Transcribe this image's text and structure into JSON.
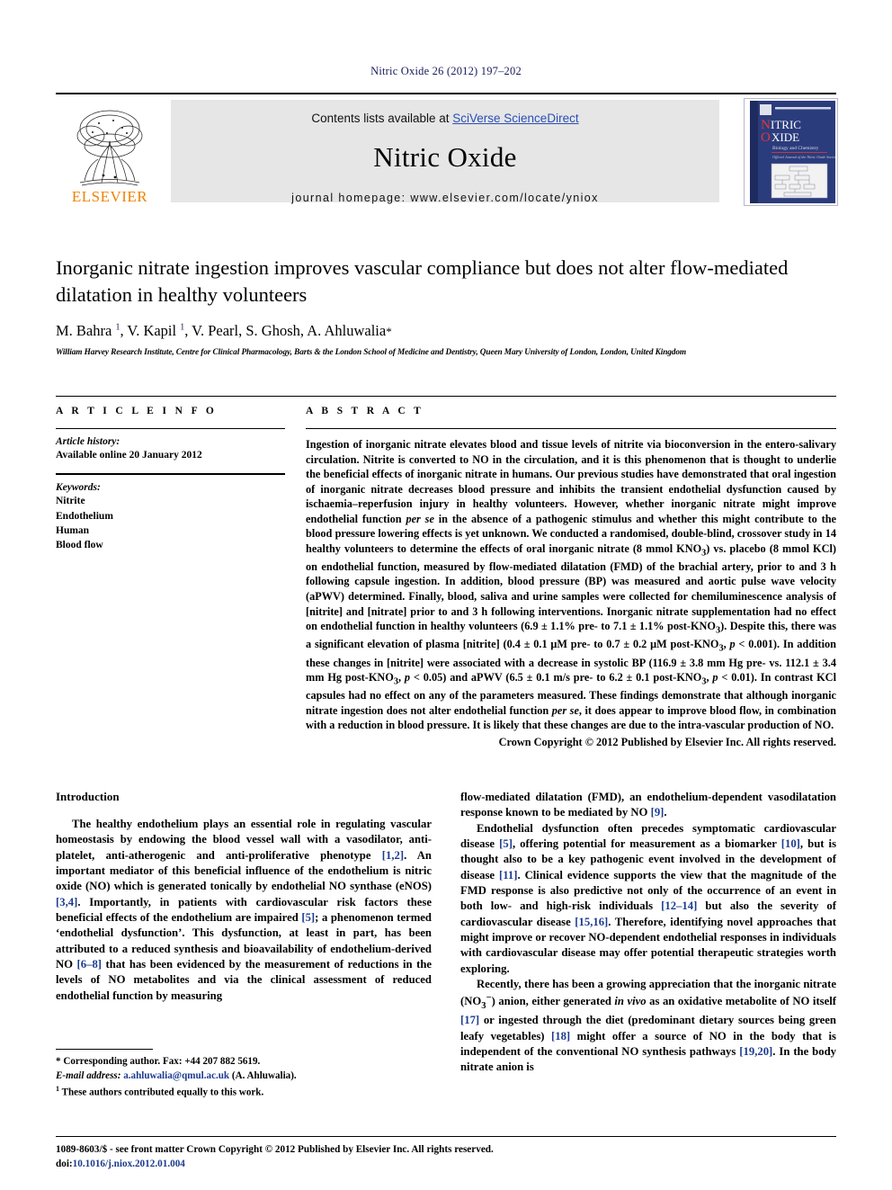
{
  "running_head": "Nitric Oxide 26 (2012) 197–202",
  "header": {
    "publisher_name": "ELSEVIER",
    "contents_prefix": "Contents lists available at ",
    "contents_link": "SciVerse ScienceDirect",
    "journal_title": "Nitric Oxide",
    "homepage_label": "journal homepage: www.elsevier.com/locate/yniox",
    "cover": {
      "line1": "NITRIC",
      "line2": "OXIDE",
      "subtitle": "Biology and Chemistry",
      "society": "Official Journal of the Nitric Oxide Society"
    },
    "link_color": "#2a4fb5"
  },
  "article": {
    "title": "Inorganic nitrate ingestion improves vascular compliance but does not alter flow-mediated dilatation in healthy volunteers",
    "authors_html": "M. Bahra <sup>1</sup>, V. Kapil <sup>1</sup>, V. Pearl, S. Ghosh, A. Ahluwalia<span class=\"star\">*</span>",
    "affiliation": "William Harvey Research Institute, Centre for Clinical Pharmacology, Barts & the London School of Medicine and Dentistry, Queen Mary University of London, London, United Kingdom"
  },
  "article_info": {
    "heading": "A R T I C L E   I N F O",
    "history_label": "Article history:",
    "history_value": "Available online 20 January 2012",
    "keywords_label": "Keywords:",
    "keywords": [
      "Nitrite",
      "Endothelium",
      "Human",
      "Blood flow"
    ]
  },
  "abstract": {
    "heading": "A B S T R A C T",
    "body_html": "Ingestion of inorganic nitrate elevates blood and tissue levels of nitrite via bioconversion in the entero-salivary circulation. Nitrite is converted to NO in the circulation, and it is this phenomenon that is thought to underlie the beneficial effects of inorganic nitrate in humans. Our previous studies have demonstrated that oral ingestion of inorganic nitrate decreases blood pressure and inhibits the transient endothelial dysfunction caused by ischaemia–reperfusion injury in healthy volunteers. However, whether inorganic nitrate might improve endothelial function <span class=\"ital\">per se</span> in the absence of a pathogenic stimulus and whether this might contribute to the blood pressure lowering effects is yet unknown. We conducted a randomised, double-blind, crossover study in 14 healthy volunteers to determine the effects of oral inorganic nitrate (8 mmol KNO<sub>3</sub>) vs. placebo (8 mmol KCl) on endothelial function, measured by flow-mediated dilatation (FMD) of the brachial artery, prior to and 3 h following capsule ingestion. In addition, blood pressure (BP) was measured and aortic pulse wave velocity (aPWV) determined. Finally, blood, saliva and urine samples were collected for chemiluminescence analysis of [nitrite] and [nitrate] prior to and 3 h following interventions. Inorganic nitrate supplementation had no effect on endothelial function in healthy volunteers (6.9 ± 1.1% pre- to 7.1 ± 1.1% post-KNO<sub>3</sub>). Despite this, there was a significant elevation of plasma [nitrite] (0.4 ± 0.1 μM pre- to 0.7 ± 0.2 μM post-KNO<sub>3</sub>, <span class=\"ital\">p</span> &lt; 0.001). In addition these changes in [nitrite] were associated with a decrease in systolic BP (116.9 ± 3.8 mm Hg pre- vs. 112.1 ± 3.4 mm Hg post-KNO<sub>3</sub>, <span class=\"ital\">p</span> &lt; 0.05) and aPWV (6.5 ± 0.1 m/s pre- to 6.2 ± 0.1 post-KNO<sub>3</sub>, <span class=\"ital\">p</span> &lt; 0.01). In contrast KCl capsules had no effect on any of the parameters measured. These findings demonstrate that although inorganic nitrate ingestion does not alter endothelial function <span class=\"ital\">per se</span>, it does appear to improve blood flow, in combination with a reduction in blood pressure. It is likely that these changes are due to the intra-vascular production of NO.",
    "copyright": "Crown Copyright © 2012 Published by Elsevier Inc. All rights reserved."
  },
  "introduction": {
    "heading": "Introduction",
    "left_p1_html": "The healthy endothelium plays an essential role in regulating vascular homeostasis by endowing the blood vessel wall with a vasodilator, anti-platelet, anti-atherogenic and anti-proliferative phenotype <span class=\"ref\">[1,2]</span>. An important mediator of this beneficial influence of the endothelium is nitric oxide (NO) which is generated tonically by endothelial NO synthase (eNOS) <span class=\"ref\">[3,4]</span>. Importantly, in patients with cardiovascular risk factors these beneficial effects of the endothelium are impaired <span class=\"ref\">[5]</span>; a phenomenon termed ‘endothelial dysfunction’. This dysfunction, at least in part, has been attributed to a reduced synthesis and bioavailability of endothelium-derived NO <span class=\"ref\">[6–8]</span> that has been evidenced by the measurement of reductions in the levels of NO metabolites and via the clinical assessment of reduced endothelial function by measuring",
    "right_p1_html": "flow-mediated dilatation (FMD), an endothelium-dependent vasodilatation response known to be mediated by NO <span class=\"ref\">[9]</span>.",
    "right_p2_html": "Endothelial dysfunction often precedes symptomatic cardiovascular disease <span class=\"ref\">[5]</span>, offering potential for measurement as a biomarker <span class=\"ref\">[10]</span>, but is thought also to be a key pathogenic event involved in the development of disease <span class=\"ref\">[11]</span>. Clinical evidence supports the view that the magnitude of the FMD response is also predictive not only of the occurrence of an event in both low- and high-risk individuals <span class=\"ref\">[12–14]</span> but also the severity of cardiovascular disease <span class=\"ref\">[15,16]</span>. Therefore, identifying novel approaches that might improve or recover NO-dependent endothelial responses in individuals with cardiovascular disease may offer potential therapeutic strategies worth exploring.",
    "right_p3_html": "Recently, there has been a growing appreciation that the inorganic nitrate (NO<sub>3</sub><sup>−</sup>) anion, either generated <span class=\"ital\">in vivo</span> as an oxidative metabolite of NO itself <span class=\"ref\">[17]</span> or ingested through the diet (predominant dietary sources being green leafy vegetables) <span class=\"ref\">[18]</span> might offer a source of NO in the body that is independent of the conventional NO synthesis pathways <span class=\"ref\">[19,20]</span>. In the body nitrate anion is"
  },
  "footnotes": {
    "corresponding_html": "* Corresponding author. Fax: +44 207 882 5619.",
    "email_html": "<span class=\"it\">E-mail address:</span> <span class=\"mail\">a.ahluwalia@qmul.ac.uk</span> (A. Ahluwalia).",
    "equal_contrib_html": "<sup>1</sup> These authors contributed equally to this work."
  },
  "page_footer": {
    "line1": "1089-8603/$ - see front matter Crown Copyright © 2012 Published by Elsevier Inc. All rights reserved.",
    "doi_prefix": "doi:",
    "doi_value": "10.1016/j.niox.2012.01.004"
  }
}
